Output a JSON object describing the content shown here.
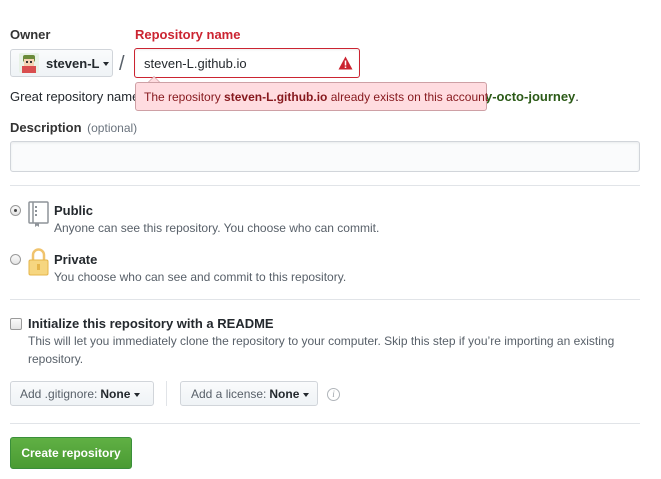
{
  "owner": {
    "label": "Owner",
    "username": "steven-L"
  },
  "separator": "/",
  "repo": {
    "label": "Repository name",
    "value": "steven-L.github.io",
    "error_prefix": "The repository ",
    "error_name": "steven-L.github.io",
    "error_suffix": " already exists on this account"
  },
  "suggestion": {
    "text_start": "Great repository name",
    "name_visible": "y-octo-journey",
    "text_end": "."
  },
  "description": {
    "label": "Description",
    "optional": "(optional)",
    "value": ""
  },
  "visibility": {
    "public": {
      "title": "Public",
      "desc": "Anyone can see this repository. You choose who can commit.",
      "selected": true
    },
    "private": {
      "title": "Private",
      "desc": "You choose who can see and commit to this repository.",
      "selected": false
    }
  },
  "readme": {
    "title": "Initialize this repository with a README",
    "desc_line1": "This will let you immediately clone the repository to your computer. Skip this step if you’re importing an existing",
    "desc_line2": "repository.",
    "checked": false
  },
  "gitignore": {
    "label": "Add .gitignore:",
    "value": "None"
  },
  "license": {
    "label": "Add a license:",
    "value": "None"
  },
  "info_glyph": "i",
  "create_button": "Create repository",
  "colors": {
    "error": "#cb2431",
    "error_bg": "#ffdce0",
    "primary_green": "#28a745",
    "text": "#24292e",
    "muted": "#586069",
    "suggestion_green": "#2b5a17"
  }
}
